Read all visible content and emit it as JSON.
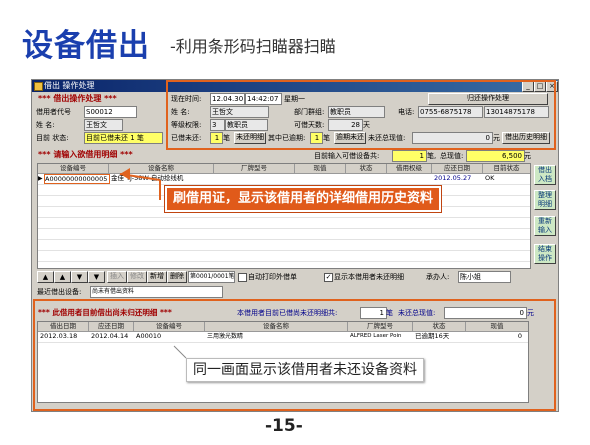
{
  "slide": {
    "title": "设备借出",
    "subtitle": "-利用条形码扫瞄器扫瞄",
    "page_number": "-15-"
  },
  "window": {
    "title": "借出 操作处理",
    "controls": [
      "_",
      "□",
      "×"
    ]
  },
  "left_panel": {
    "heading": "*** 借出操作处理 ***",
    "borrower_id_label": "借用者代号",
    "borrower_id_value": "S00012",
    "name_label": "姓     名:",
    "name_value": "王哲文",
    "status_label": "目前 状态:",
    "status_value": "目前已借未还 1 笔"
  },
  "right_panel": {
    "current_time_label": "现在时间:",
    "date_value": "12.04.30",
    "time_value": "14:42:07",
    "weekday": "星期一",
    "return_button": "归还操作处理",
    "name_label": "姓     名:",
    "name_value": "王哲文",
    "dept_label": "部门群组:",
    "dept_value": "教职员",
    "phone_label": "电话:",
    "phone_value": "0755-6875178",
    "mobile_value": "13014875178",
    "level_label": "等级权限:",
    "level_value": "3",
    "level_name": "教职员",
    "days_label": "可借天数:",
    "days_value": "28",
    "days_unit": "天",
    "unreturned_label": "已借未还:",
    "unreturned_value": "1",
    "unreturned_unit": "笔",
    "unreturned_detail_btn": "未还明细",
    "overdue_label": "其中已逾期:",
    "overdue_value": "1",
    "overdue_unit": "笔",
    "overdue_detail_btn": "逾期未还",
    "total_value_label": "未还总现值:",
    "total_value": "0",
    "total_unit": "元",
    "history_button": "借出历史明细"
  },
  "input_section": {
    "heading": "*** 请输入欲借用明细 ***",
    "can_borrow_label": "目前输入可借设备共:",
    "can_borrow_count": "1",
    "can_borrow_unit": "笔,",
    "total_value_label": "总现值:",
    "total_value": "6,500",
    "total_unit": "元"
  },
  "borrow_grid": {
    "columns": [
      "设备编号",
      "设备名称",
      "厂牌型号",
      "现值",
      "状态",
      "借用权级",
      "应还日期",
      "目前状态"
    ],
    "rows": [
      {
        "code": "A00000000000005",
        "name": "金佳 TJ-58W 自动捻线机",
        "model": "",
        "value": "",
        "status": "",
        "level": "",
        "due": "2012.05.27",
        "state": "OK"
      }
    ]
  },
  "side_buttons": [
    "借出入档",
    "整理明细",
    "重新输入",
    "结束操作"
  ],
  "toolbar": {
    "nav_buttons": [
      "▲",
      "▲",
      "▼",
      "▼"
    ],
    "insert_label": "插入",
    "modify_label": "修改",
    "add_label": "新增",
    "delete_label": "删除",
    "record_indicator": "第0001/0001笔",
    "auto_print_label": "自动打印外借单",
    "show_unreturned_label": "显示本借用者未还明细",
    "handler_label": "承办人:",
    "handler_value": "陈小姐"
  },
  "recent": {
    "label": "最近借出设备:",
    "value": "尚未有借出资料"
  },
  "unreturned_section": {
    "heading": "*** 此借用者目前借出尚未归还明细 ***",
    "count_label": "本借用者目前已借尚未还明细共:",
    "count_value": "1",
    "count_unit": "笔",
    "total_label": "未还总现值:",
    "total_value": "0",
    "total_unit": "元",
    "columns": [
      "借出日期",
      "应还日期",
      "设备编号",
      "设备名称",
      "厂牌型号",
      "状态",
      "现值"
    ],
    "rows": [
      {
        "borrow_date": "2012.03.18",
        "due_date": "2012.04.14",
        "code": "A00010",
        "name": "三用激光数睛",
        "model": "ALFRED Laser Poin",
        "status": "已逾期16天",
        "value": "0"
      }
    ]
  },
  "callouts": {
    "card_scan_note": "刷借用证，显示该借用者的详细借用历史资料",
    "same_screen_note": "同一画面显示该借用者未还设备资料"
  },
  "colors": {
    "title_blue": "#1a3fae",
    "highlight_orange": "#e0621e",
    "heading_red": "#a00000",
    "status_yellow": "#ffff66"
  }
}
